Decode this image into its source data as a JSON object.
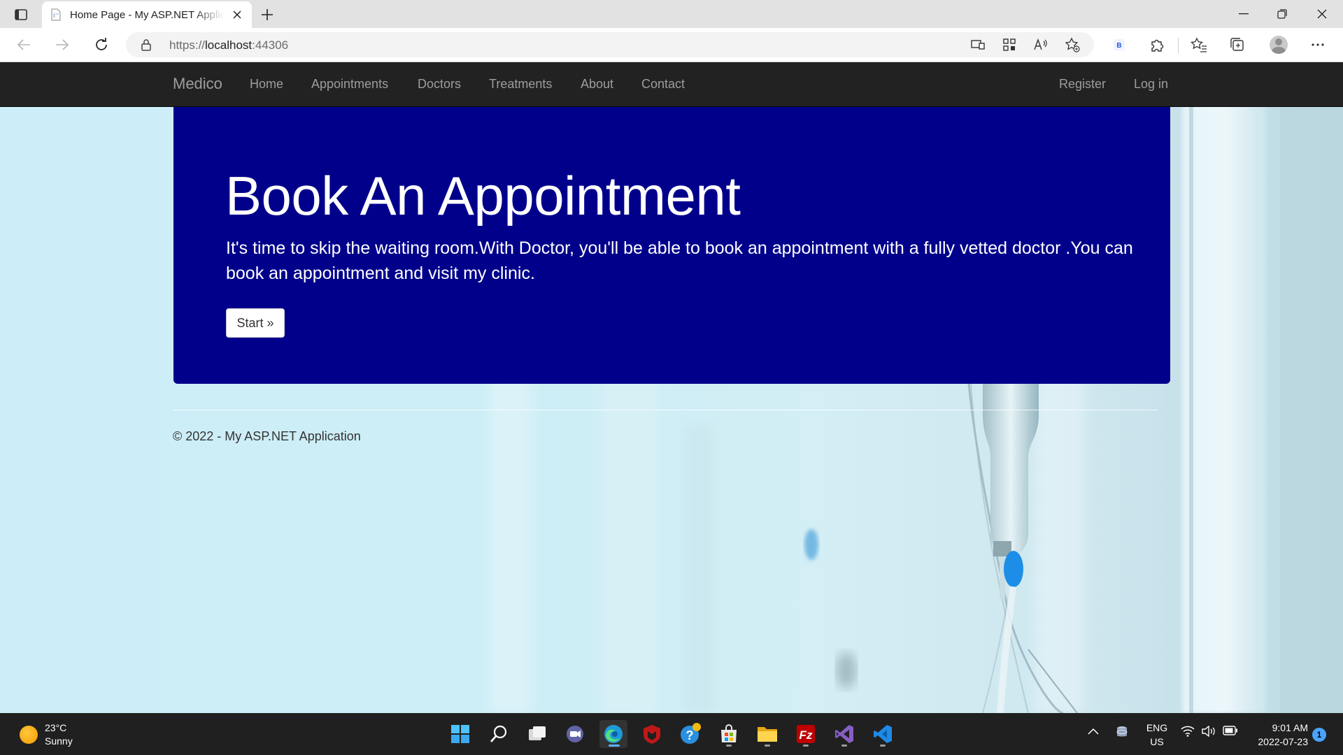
{
  "browser": {
    "tab_title": "Home Page - My ASP.NET Application",
    "url_protocol": "https://",
    "url_host": "localhost",
    "url_port": ":44306"
  },
  "site": {
    "brand": "Medico",
    "nav": {
      "home": "Home",
      "appointments": "Appointments",
      "doctors": "Doctors",
      "treatments": "Treatments",
      "about": "About",
      "contact": "Contact",
      "register": "Register",
      "login": "Log in"
    },
    "hero": {
      "title": "Book An Appointment",
      "text": "It's time to skip the waiting room.With Doctor, you'll be able to book an appointment with a fully vetted doctor .You can book an appointment and visit my clinic.",
      "button": "Start »"
    },
    "footer": "© 2022 - My ASP.NET Application",
    "colors": {
      "navbar": "#222222",
      "hero": "#00008b",
      "nav_text": "#9d9d9d"
    }
  },
  "taskbar": {
    "weather_temp": "23°C",
    "weather_desc": "Sunny",
    "lang_1": "ENG",
    "lang_2": "US",
    "time": "9:01 AM",
    "date": "2022-07-23",
    "notification_count": "1",
    "apps": [
      "start-icon",
      "search-icon",
      "task-view-icon",
      "chat-icon",
      "edge-icon",
      "mcafee-icon",
      "help-icon",
      "store-icon",
      "file-explorer-icon",
      "filezilla-icon",
      "visual-studio-icon",
      "vscode-icon"
    ]
  }
}
